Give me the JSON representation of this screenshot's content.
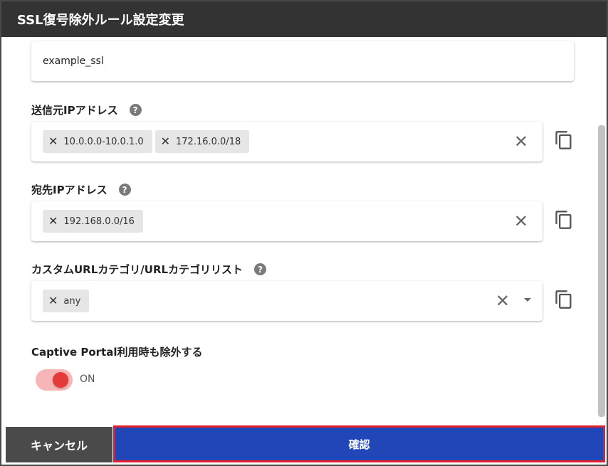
{
  "dialog": {
    "title": "SSL復号除外ルール設定変更"
  },
  "rule_name": {
    "value": "example_ssl"
  },
  "source_ip": {
    "label": "送信元IPアドレス",
    "chips": [
      "10.0.0.0-10.0.1.0",
      "172.16.0.0/18"
    ]
  },
  "destination_ip": {
    "label": "宛先IPアドレス",
    "chips": [
      "192.168.0.0/16"
    ]
  },
  "url_category": {
    "label": "カスタムURLカテゴリ/URLカテゴリリスト",
    "chips": [
      "any"
    ]
  },
  "captive_portal": {
    "label": "Captive Portal利用時も除外する",
    "state": "ON",
    "enabled": true
  },
  "footer": {
    "cancel_label": "キャンセル",
    "confirm_label": "確認"
  },
  "icons": {
    "help": "help-circle-icon",
    "chip_remove": "close-icon",
    "clear": "close-icon",
    "dropdown": "caret-down-icon",
    "copy": "copy-icon"
  },
  "colors": {
    "titlebar": "#333333",
    "confirm": "#2146b8",
    "confirm_outline": "#e01e2e",
    "cancel": "#4a4a4a",
    "toggle_on": "#e53a3a"
  }
}
